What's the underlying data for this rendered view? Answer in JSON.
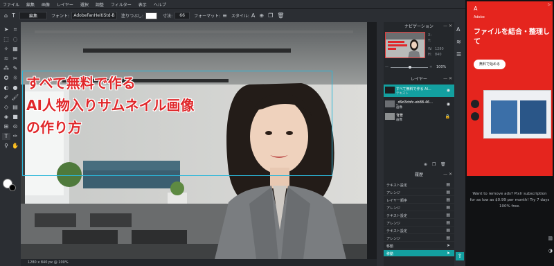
{
  "menu": [
    "ファイル",
    "編集",
    "画像",
    "レイヤー",
    "選択",
    "調整",
    "フィルター",
    "表示",
    "ヘルプ"
  ],
  "options": {
    "edit_label": "編集",
    "font_label": "フォント:",
    "font_value": "AdobeFanHeitiStd-B",
    "fill_label": "塗りつぶし:",
    "fill_color": "#ffffff",
    "size_label": "寸法:",
    "size_value": "66",
    "format_label": "フォーマット:",
    "style_label": "スタイル:"
  },
  "canvas": {
    "headline": [
      "すべて無料で作る",
      "AI人物入りサムネイル画像",
      "の作り方"
    ],
    "headline_color": "#e0272a",
    "status": "1280 x 840 px @ 100%"
  },
  "navigator": {
    "title": "ナビゲーション",
    "x_label": "X:",
    "y_label": "Y:",
    "w_label": "W:",
    "w_value": "1280",
    "h_label": "H:",
    "h_value": "840",
    "zoom": "100%"
  },
  "layers": {
    "title": "レイヤー",
    "items": [
      {
        "name": "すべて無料で作る AI...",
        "type": "テキスト",
        "active": true
      },
      {
        "name": "_d9d3cbfc-eb88-46...",
        "type": "画像",
        "active": false
      },
      {
        "name": "背景",
        "type": "画像",
        "active": false
      }
    ]
  },
  "history": {
    "title": "履歴",
    "items": [
      {
        "label": "テキスト設定",
        "active": false
      },
      {
        "label": "アレンジ",
        "active": false
      },
      {
        "label": "レイヤー順序",
        "active": false
      },
      {
        "label": "アレンジ",
        "active": false
      },
      {
        "label": "テキスト設定",
        "active": false
      },
      {
        "label": "アレンジ",
        "active": false
      },
      {
        "label": "テキスト設定",
        "active": false
      },
      {
        "label": "アレンジ",
        "active": false
      },
      {
        "label": "移動",
        "active": false
      },
      {
        "label": "移動",
        "active": true
      }
    ]
  },
  "ad": {
    "brand": "Adobe",
    "headline": "ファイルを結合・整理して",
    "button": "無料で始める",
    "remove_text": "Want to remove ads? Pixlr subscription for as low as $0.99 per month! Try 7 days 100% free.",
    "brand_color": "#e5251e"
  },
  "accent_color": "#13a0a0"
}
